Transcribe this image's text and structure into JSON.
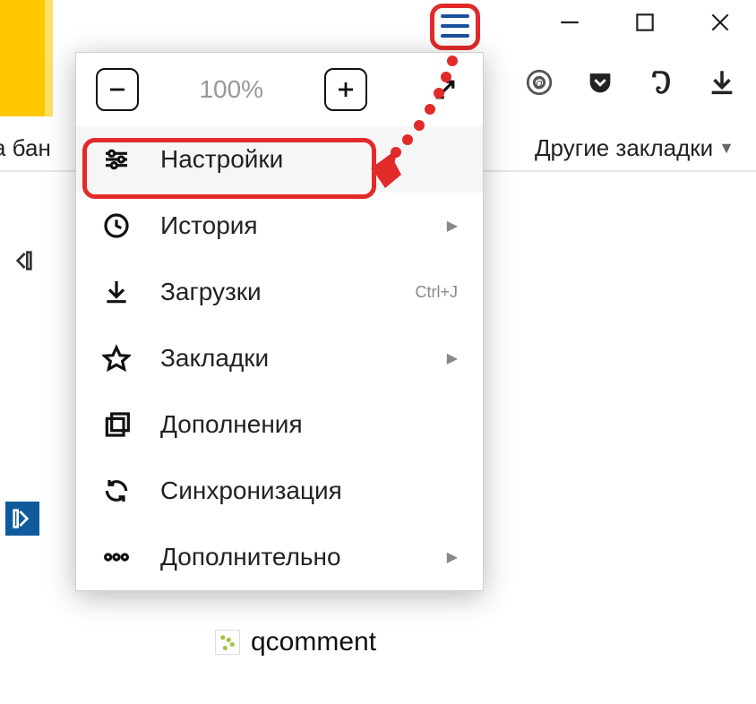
{
  "window_controls": {
    "minimize": "—",
    "maximize": "▢",
    "close": "✕"
  },
  "toolbar_icons": [
    "target-icon",
    "pocket-icon",
    "evernote-icon",
    "download-icon"
  ],
  "bookmarks_bar": {
    "left_fragment": "а бан",
    "other_bookmarks": "Другие закладки"
  },
  "zoom": {
    "level": "100%"
  },
  "menu": {
    "settings": {
      "label": "Настройки"
    },
    "history": {
      "label": "История",
      "submenu": true
    },
    "downloads": {
      "label": "Загрузки",
      "shortcut": "Ctrl+J"
    },
    "bookmarks": {
      "label": "Закладки",
      "submenu": true
    },
    "addons": {
      "label": "Дополнения"
    },
    "sync": {
      "label": "Синхронизация"
    },
    "more": {
      "label": "Дополнительно",
      "submenu": true
    }
  },
  "tab": {
    "title": "qcomment"
  }
}
